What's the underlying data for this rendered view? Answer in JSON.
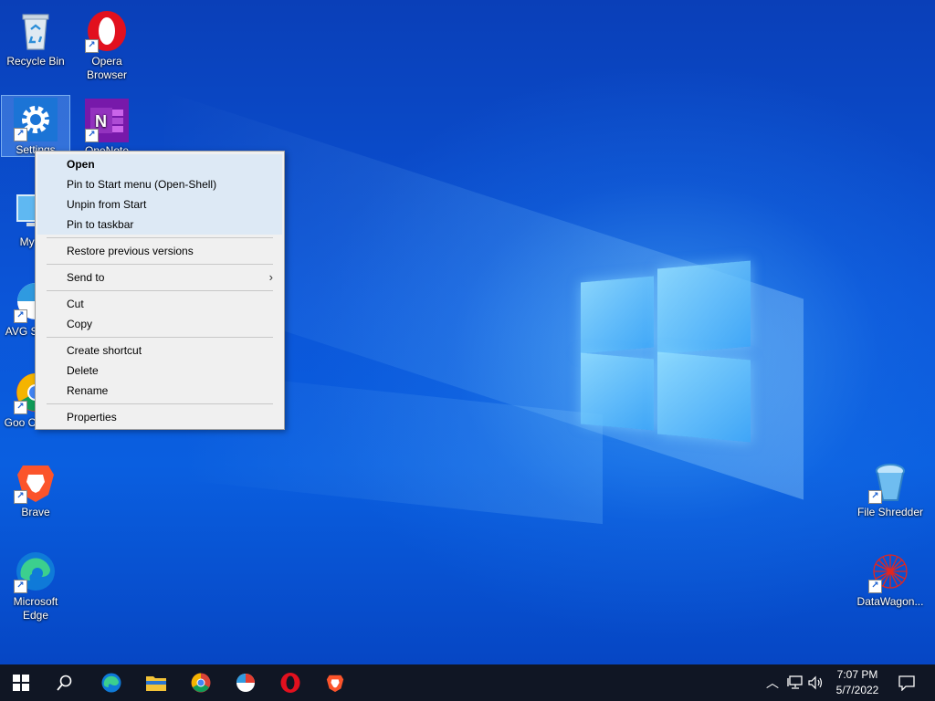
{
  "desktop": {
    "icons": [
      {
        "label": "Recycle Bin"
      },
      {
        "label": "Opera Browser"
      },
      {
        "label": "Settings"
      },
      {
        "label": "OneNote"
      },
      {
        "label": "My Co"
      },
      {
        "label": "AVG S Brow"
      },
      {
        "label": "Goo Chrome"
      },
      {
        "label": "Brave"
      },
      {
        "label": "Microsoft Edge"
      },
      {
        "label": "File Shredder"
      },
      {
        "label": "DataWagon..."
      }
    ]
  },
  "context_menu": {
    "items": [
      {
        "label": "Open"
      },
      {
        "label": "Pin to Start menu (Open-Shell)"
      },
      {
        "label": "Unpin from Start"
      },
      {
        "label": "Pin to taskbar"
      },
      {
        "label": "Restore previous versions"
      },
      {
        "label": "Send to"
      },
      {
        "label": "Cut"
      },
      {
        "label": "Copy"
      },
      {
        "label": "Create shortcut"
      },
      {
        "label": "Delete"
      },
      {
        "label": "Rename"
      },
      {
        "label": "Properties"
      }
    ]
  },
  "taskbar": {
    "time": "7:07 PM",
    "date": "5/7/2022"
  },
  "colors": {
    "accent": "#0a5fe0",
    "taskbar": "#101624",
    "menu_bg": "#f0f0f0",
    "menu_highlight": "#dde9f5"
  }
}
